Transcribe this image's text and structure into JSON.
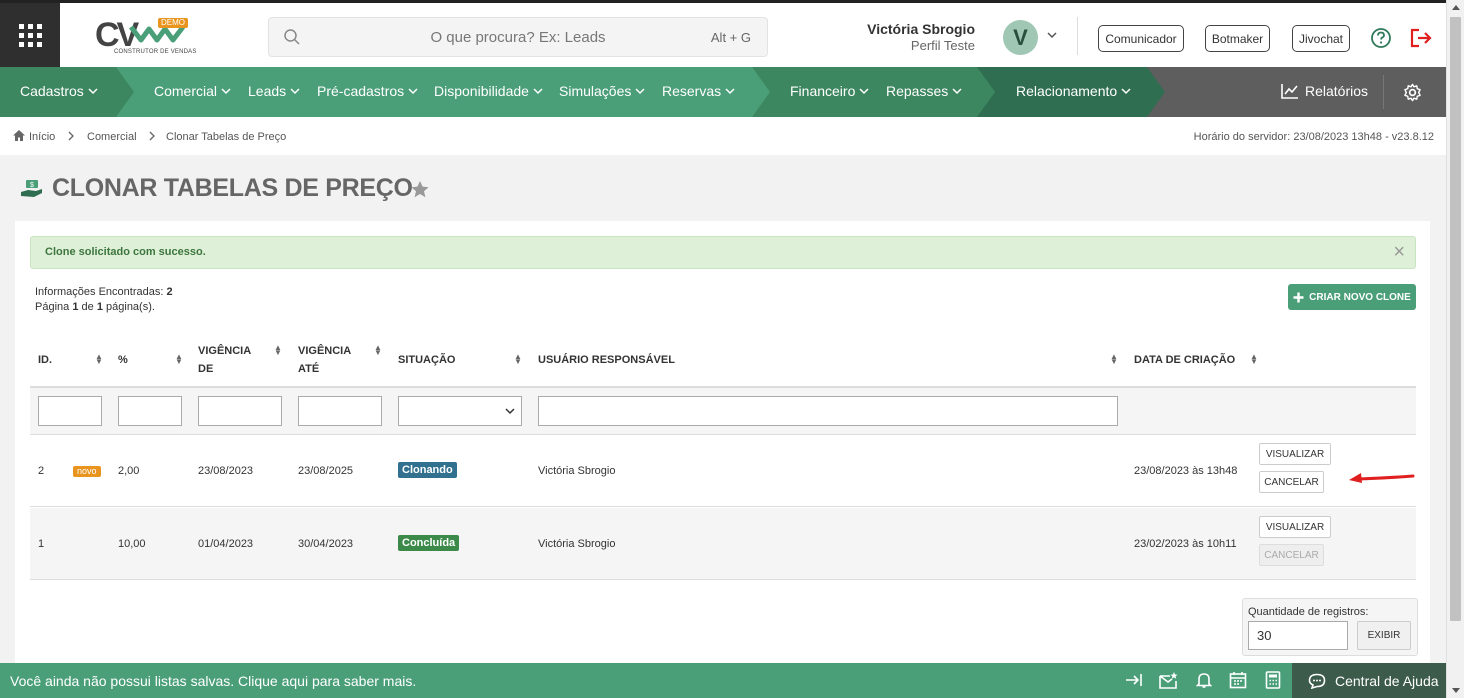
{
  "header": {
    "logo_text": "CV",
    "logo_demo": "DEMO",
    "logo_sub": "CONSTRUTOR DE VENDAS",
    "search_placeholder": "O que procura? Ex: Leads",
    "search_shortcut": "Alt + G",
    "user_name": "Victória Sbrogio",
    "user_profile": "Perfil Teste",
    "avatar_letter": "V",
    "pills": [
      "Comunicador",
      "Botmaker",
      "Jivochat"
    ]
  },
  "nav": {
    "items": [
      "Cadastros",
      "Comercial",
      "Leads",
      "Pré-cadastros",
      "Disponibilidade",
      "Simulações",
      "Reservas",
      "Financeiro",
      "Repasses",
      "Relacionamento"
    ],
    "reports": "Relatórios"
  },
  "breadcrumb": {
    "items": [
      "Início",
      "Comercial",
      "Clonar Tabelas de Preço"
    ],
    "server_time": "Horário do servidor: 23/08/2023 13h48 - v23.8.12"
  },
  "page": {
    "title": "CLONAR TABELAS DE PREÇO",
    "alert": "Clone solicitado com sucesso.",
    "info_found_label": "Informações Encontradas:",
    "info_found_value": "2",
    "page_word": "Página",
    "page_current": "1",
    "page_of": "de",
    "page_total": "1",
    "page_suffix": "página(s).",
    "new_clone_button": "CRIAR NOVO CLONE"
  },
  "table": {
    "headers": {
      "id": "ID.",
      "pct": "%",
      "vig_de_1": "VIGÊNCIA",
      "vig_de_2": "DE",
      "vig_ate_1": "VIGÊNCIA",
      "vig_ate_2": "ATÉ",
      "situacao": "SITUAÇÃO",
      "usuario": "USUÁRIO RESPONSÁVEL",
      "data": "DATA DE CRIAÇÃO"
    },
    "rows": [
      {
        "id": "2",
        "badge": "novo",
        "pct": "2,00",
        "vig_de": "23/08/2023",
        "vig_ate": "23/08/2025",
        "status": "Clonando",
        "user": "Victória Sbrogio",
        "created": "23/08/2023 às 13h48",
        "view": "VISUALIZAR",
        "cancel": "CANCELAR"
      },
      {
        "id": "1",
        "badge": "",
        "pct": "10,00",
        "vig_de": "01/04/2023",
        "vig_ate": "30/04/2023",
        "status": "Concluída",
        "user": "Victória Sbrogio",
        "created": "23/02/2023 às 10h11",
        "view": "VISUALIZAR",
        "cancel": "CANCELAR"
      }
    ]
  },
  "records": {
    "label": "Quantidade de registros:",
    "value": "30",
    "button": "EXIBIR"
  },
  "footer": {
    "text": "Você ainda não possui listas salvas. Clique aqui para saber mais.",
    "help": "Central de Ajuda"
  },
  "colors": {
    "brand_green": "#4a9f79",
    "nav_green_dark": "#2f6e50",
    "status_clonando": "#31708f",
    "status_concluida": "#3c8a4a",
    "badge_novo": "#e8941e",
    "arrow_red": "#e02020"
  }
}
